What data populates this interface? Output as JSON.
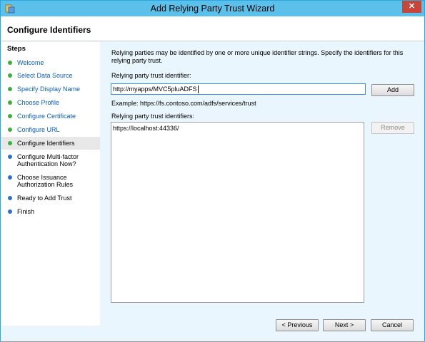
{
  "window": {
    "title": "Add Relying Party Trust Wizard",
    "close_glyph": "✕"
  },
  "header": {
    "title": "Configure Identifiers"
  },
  "steps": {
    "title": "Steps",
    "items": [
      {
        "label": "Welcome",
        "state": "done",
        "link": true
      },
      {
        "label": "Select Data Source",
        "state": "done",
        "link": true
      },
      {
        "label": "Specify Display Name",
        "state": "done",
        "link": true
      },
      {
        "label": "Choose Profile",
        "state": "done",
        "link": true
      },
      {
        "label": "Configure Certificate",
        "state": "done",
        "link": true
      },
      {
        "label": "Configure URL",
        "state": "done",
        "link": true
      },
      {
        "label": "Configure Identifiers",
        "state": "current",
        "link": false
      },
      {
        "label": "Configure Multi-factor Authentication Now?",
        "state": "pending",
        "link": false
      },
      {
        "label": "Choose Issuance Authorization Rules",
        "state": "pending",
        "link": false
      },
      {
        "label": "Ready to Add Trust",
        "state": "pending",
        "link": false
      },
      {
        "label": "Finish",
        "state": "pending",
        "link": false
      }
    ]
  },
  "main": {
    "description": "Relying parties may be identified by one or more unique identifier strings. Specify the identifiers for this relying party trust.",
    "identifier_label": "Relying party trust identifier:",
    "identifier_value": "http://myapps/MVC5pluADFS",
    "add_label": "Add",
    "example_text": "Example: https://fs.contoso.com/adfs/services/trust",
    "identifiers_label": "Relying party trust identifiers:",
    "identifiers": [
      "https://localhost:44336/"
    ],
    "remove_label": "Remove"
  },
  "footer": {
    "previous_label": "< Previous",
    "next_label": "Next >",
    "cancel_label": "Cancel"
  },
  "colors": {
    "titlebar": "#5cc1ea",
    "close": "#c7463a",
    "done_dot": "#3cb13c",
    "pending_dot": "#2a6fd6",
    "link": "#0a5fc4"
  }
}
